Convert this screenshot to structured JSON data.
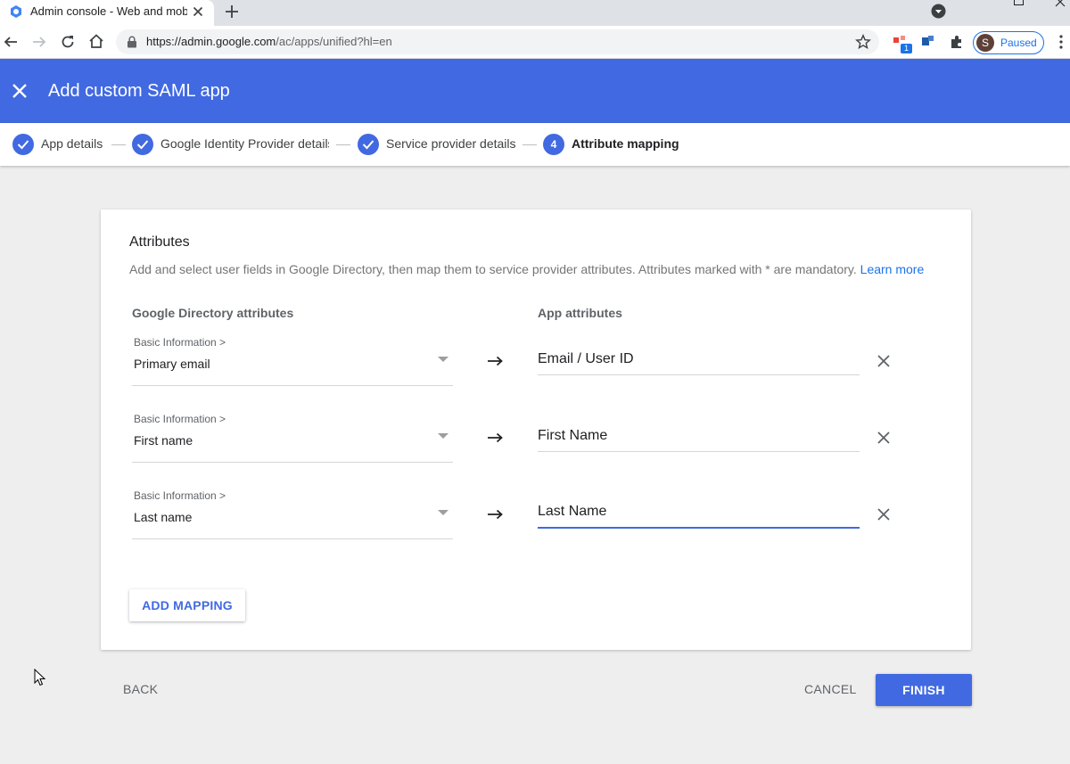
{
  "browser": {
    "tab_title": "Admin console - Web and mobile apps",
    "url_host": "https://admin.google.com",
    "url_path": "/ac/apps/unified?hl=en",
    "extension_badge": "1",
    "profile_initial": "S",
    "profile_status": "Paused"
  },
  "header": {
    "title": "Add custom SAML app"
  },
  "stepper": {
    "steps": [
      {
        "label": "App details",
        "state": "done"
      },
      {
        "label": "Google Identity Provider details",
        "state": "done"
      },
      {
        "label": "Service provider details",
        "state": "done"
      },
      {
        "label": "Attribute mapping",
        "state": "active",
        "number": "4"
      }
    ]
  },
  "card": {
    "title": "Attributes",
    "description": "Add and select user fields in Google Directory, then map them to service provider attributes. Attributes marked with * are mandatory.",
    "learn_more": "Learn more",
    "col_directory": "Google Directory attributes",
    "col_app": "App attributes",
    "mappings": [
      {
        "category": "Basic Information >",
        "field": "Primary email",
        "app_attribute": "Email / User ID"
      },
      {
        "category": "Basic Information >",
        "field": "First name",
        "app_attribute": "First Name"
      },
      {
        "category": "Basic Information >",
        "field": "Last name",
        "app_attribute": "Last Name"
      }
    ],
    "add_mapping": "ADD MAPPING"
  },
  "footer": {
    "back": "BACK",
    "cancel": "CANCEL",
    "finish": "FINISH"
  },
  "colors": {
    "brand_blue": "#4169e1",
    "link_blue": "#1a73e8"
  }
}
